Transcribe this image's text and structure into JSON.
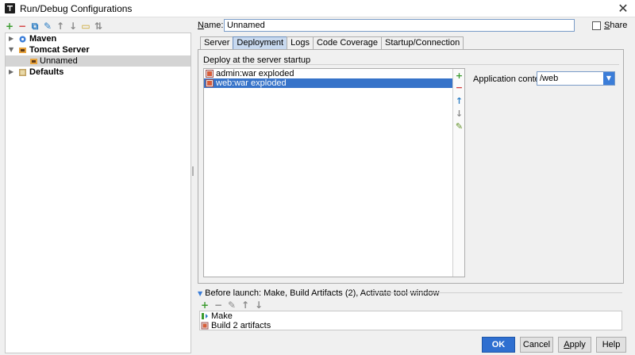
{
  "window": {
    "title": "Run/Debug Configurations",
    "close_glyph": "✕"
  },
  "left_toolbar": {
    "icons": [
      "add-icon",
      "remove-icon",
      "copy-icon",
      "edit-defaults-icon",
      "move-up-icon",
      "move-down-icon",
      "folder-icon",
      "sort-icon"
    ],
    "glyphs": [
      "+",
      "−",
      "⧉",
      "✎",
      "↑",
      "↓",
      "▭",
      "⇅"
    ]
  },
  "tree": {
    "items": [
      {
        "label": "Maven",
        "icon": "maven-icon",
        "level": 0,
        "arrow": "▶",
        "bold": true
      },
      {
        "label": "Tomcat Server",
        "icon": "tomcat-icon",
        "level": 0,
        "arrow": "▼",
        "bold": true
      },
      {
        "label": "Unnamed",
        "icon": "tomcat-icon",
        "level": 1,
        "arrow": "",
        "bold": false,
        "selected": true
      },
      {
        "label": "Defaults",
        "icon": "defaults-icon",
        "level": 0,
        "arrow": "▶",
        "bold": true
      }
    ]
  },
  "name_field": {
    "label_underlined": "N",
    "label_rest": "ame:",
    "value": "Unnamed"
  },
  "share": {
    "label_underlined": "S",
    "label_rest": "hare",
    "checked": false
  },
  "tabs": [
    {
      "label": "Server",
      "active": false
    },
    {
      "label": "Deployment",
      "active": true
    },
    {
      "label": "Logs",
      "active": false
    },
    {
      "label": "Code Coverage",
      "active": false
    },
    {
      "label": "Startup/Connection",
      "active": false
    }
  ],
  "deployment": {
    "group_label": "Deploy at the server startup",
    "items": [
      {
        "label": "admin:war exploded",
        "selected": false
      },
      {
        "label": "web:war exploded",
        "selected": true
      }
    ],
    "side_buttons": [
      {
        "icon": "add-icon",
        "glyph": "+"
      },
      {
        "icon": "remove-icon",
        "glyph": "−"
      },
      {
        "icon": "move-up-icon",
        "glyph": "↑"
      },
      {
        "icon": "move-down-icon",
        "glyph": "↓"
      },
      {
        "icon": "edit-icon",
        "glyph": "✎"
      }
    ],
    "context_label": "Application context:",
    "context_value": "/web",
    "dropdown_glyph": "▼"
  },
  "before_launch": {
    "header": "Before launch: Make, Build Artifacts (2), Activate tool window",
    "expand_glyph": "▼",
    "toolbar_glyphs": [
      "+",
      "−",
      "✎",
      "↑",
      "↓"
    ],
    "items": [
      {
        "label": "Make",
        "icon": "make-icon"
      },
      {
        "label": "Build 2 artifacts",
        "icon": "artifact-icon"
      }
    ]
  },
  "buttons": {
    "ok": "OK",
    "cancel": "Cancel",
    "apply_underlined": "A",
    "apply_rest": "pply",
    "help": "Help"
  },
  "colors": {
    "accent": "#2f6fd0",
    "selection": "#3673c9",
    "active_tab": "#c8d9ef",
    "add_green": "#3a9b2e",
    "remove_red": "#d43b3b"
  }
}
